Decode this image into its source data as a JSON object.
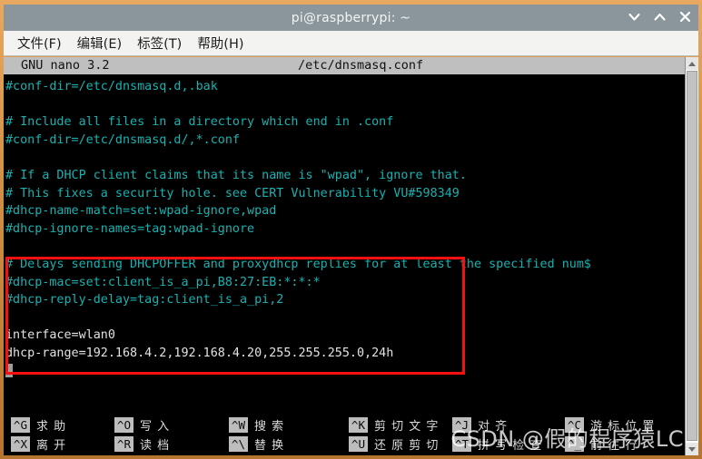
{
  "window": {
    "title": "pi@raspberrypi: ~",
    "controls": [
      {
        "name": "minimize",
        "icon": "chevron-down-icon"
      },
      {
        "name": "maximize",
        "icon": "chevron-up-icon"
      },
      {
        "name": "close",
        "icon": "close-icon"
      }
    ]
  },
  "menubar": {
    "items": [
      {
        "label": "文件(F)"
      },
      {
        "label": "编辑(E)"
      },
      {
        "label": "标签(T)"
      },
      {
        "label": "帮助(H)"
      }
    ]
  },
  "nano": {
    "version": "GNU nano 3.2",
    "filename": "/etc/dnsmasq.conf",
    "lines": [
      {
        "text": "#conf-dir=/etc/dnsmasq.d,.bak",
        "style": "comment"
      },
      {
        "text": "",
        "style": "blank"
      },
      {
        "text": "# Include all files in a directory which end in .conf",
        "style": "comment"
      },
      {
        "text": "#conf-dir=/etc/dnsmasq.d/,*.conf",
        "style": "comment"
      },
      {
        "text": "",
        "style": "blank"
      },
      {
        "text": "# If a DHCP client claims that its name is \"wpad\", ignore that.",
        "style": "comment"
      },
      {
        "text": "# This fixes a security hole. see CERT Vulnerability VU#598349",
        "style": "comment"
      },
      {
        "text": "#dhcp-name-match=set:wpad-ignore,wpad",
        "style": "comment"
      },
      {
        "text": "#dhcp-ignore-names=tag:wpad-ignore",
        "style": "comment"
      },
      {
        "text": "",
        "style": "blank"
      },
      {
        "text": "# Delays sending DHCPOFFER and proxydhcp replies for at least the specified num$",
        "style": "comment"
      },
      {
        "text": "#dhcp-mac=set:client_is_a_pi,B8:27:EB:*:*:*",
        "style": "comment"
      },
      {
        "text": "#dhcp-reply-delay=tag:client_is_a_pi,2",
        "style": "comment"
      },
      {
        "text": "",
        "style": "blank"
      },
      {
        "text": "interface=wlan0",
        "style": "active"
      },
      {
        "text": "dhcp-range=192.168.4.2,192.168.4.20,255.255.255.0,24h",
        "style": "active"
      },
      {
        "text": "",
        "style": "cursor"
      }
    ],
    "help": {
      "row1": [
        {
          "key": "^G",
          "label": "求 助"
        },
        {
          "key": "^O",
          "label": "写 入"
        },
        {
          "key": "^W",
          "label": "搜 索"
        },
        {
          "key": "^K",
          "label": "剪 切 文 字"
        },
        {
          "key": "^J",
          "label": "对 齐"
        },
        {
          "key": "^C",
          "label": "游 标 位 置"
        }
      ],
      "row2": [
        {
          "key": "^X",
          "label": "离 开"
        },
        {
          "key": "^R",
          "label": "读 档"
        },
        {
          "key": "^\\",
          "label": "替 换"
        },
        {
          "key": "^U",
          "label": "还 原 剪 切"
        },
        {
          "key": "^T",
          "label": "拼 写 检 查"
        },
        {
          "key": "^_",
          "label": "前 往 行"
        }
      ]
    }
  },
  "annotation": {
    "box_color": "#f51111"
  },
  "watermark": {
    "text": "CSDN @假的程序猿LC"
  },
  "colors": {
    "titlebar": "#8b969c",
    "menubar": "#f3f3f1",
    "terminal_bg": "#000000",
    "comment_text": "#18b2b2",
    "active_text": "#e3e3e3",
    "nano_bar": "#bfbfbf",
    "frame": "#d08f46"
  }
}
